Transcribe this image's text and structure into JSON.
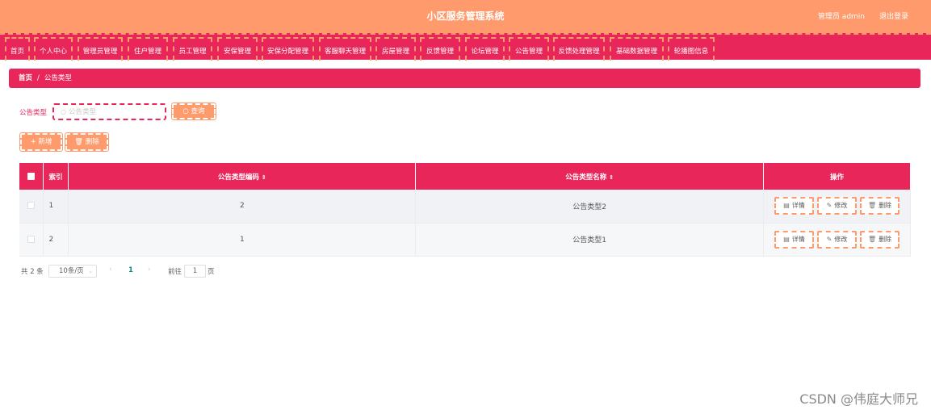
{
  "header": {
    "title": "小区服务管理系统",
    "user": "管理员 admin",
    "logout": "退出登录"
  },
  "nav": [
    {
      "label": "首页"
    },
    {
      "label": "个人中心"
    },
    {
      "label": "管理员管理"
    },
    {
      "label": "住户管理"
    },
    {
      "label": "员工管理"
    },
    {
      "label": "安保管理"
    },
    {
      "label": "安保分配管理"
    },
    {
      "label": "客服聊天管理"
    },
    {
      "label": "房屋管理"
    },
    {
      "label": "反馈管理"
    },
    {
      "label": "论坛管理"
    },
    {
      "label": "公告管理"
    },
    {
      "label": "反馈处理管理"
    },
    {
      "label": "基础数据管理"
    },
    {
      "label": "轮播图信息"
    }
  ],
  "breadcrumb": {
    "home": "首页",
    "sep": "/",
    "current": "公告类型"
  },
  "search": {
    "label": "公告类型",
    "placeholder": "公告类型",
    "button": "查询"
  },
  "actions": {
    "add": "新增",
    "delete": "删除"
  },
  "table": {
    "headers": {
      "index": "索引",
      "code": "公告类型编码",
      "name": "公告类型名称",
      "ops": "操作"
    },
    "rows": [
      {
        "index": "1",
        "code": "2",
        "name": "公告类型2"
      },
      {
        "index": "2",
        "code": "1",
        "name": "公告类型1"
      }
    ],
    "ops": {
      "detail": "详情",
      "edit": "修改",
      "delete": "删除"
    }
  },
  "pagination": {
    "total": "共 2 条",
    "page_size": "10条/页",
    "current_page": "1",
    "goto_label": "前往",
    "goto_value": "1",
    "page_unit": "页"
  },
  "watermark": "CSDN @伟庭大师兄",
  "colors": {
    "accent": "#e9265a",
    "header": "#fe9a6c"
  }
}
